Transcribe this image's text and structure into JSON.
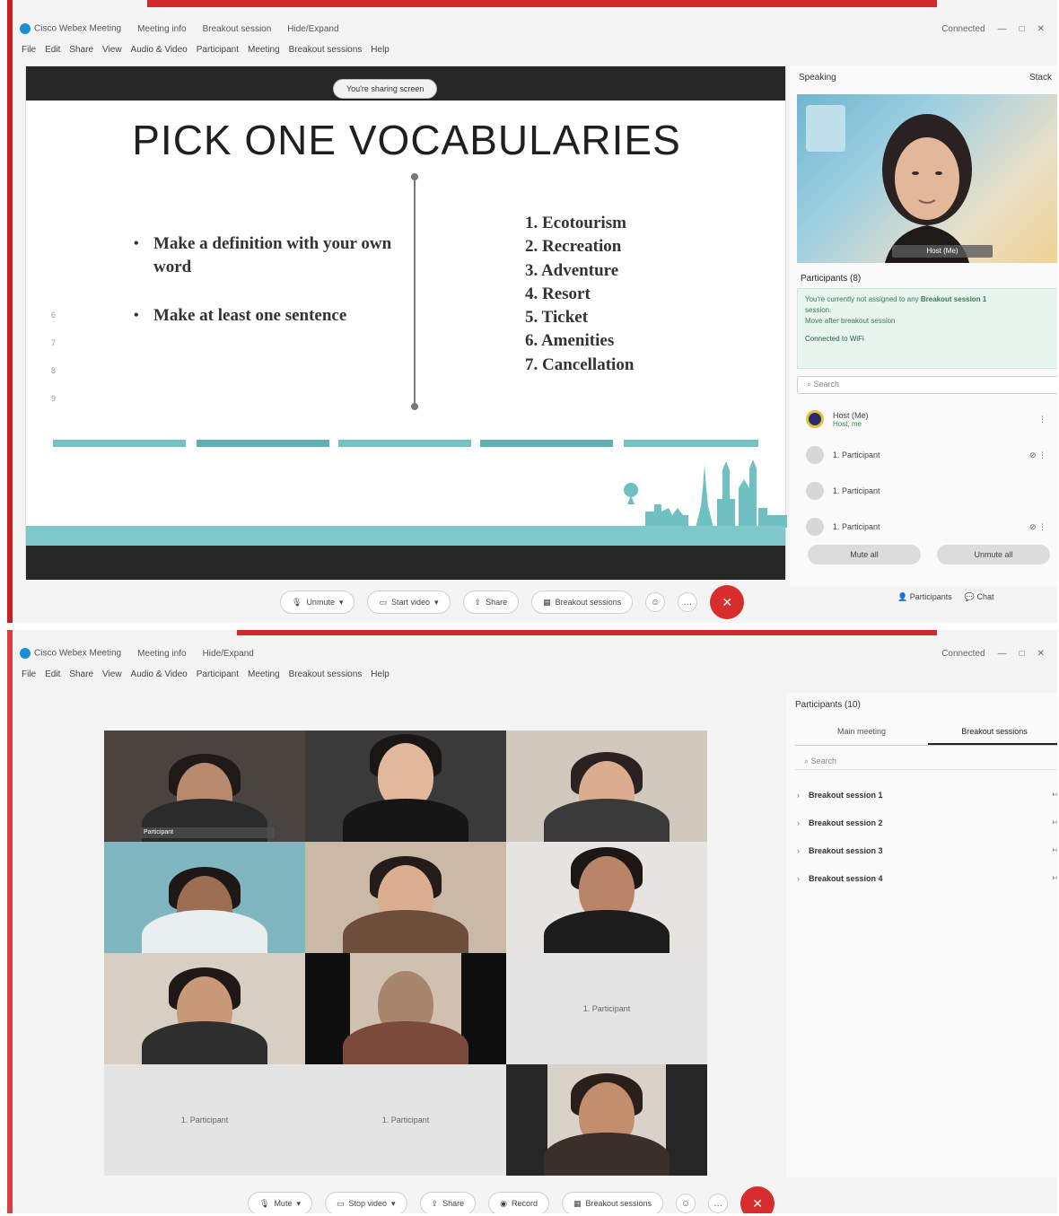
{
  "colors": {
    "accent_red": "#d22a2a",
    "slide_dark": "#262626",
    "slide_teal": "#7ec8c9",
    "panel_green": "#e8f4ee"
  },
  "top": {
    "titlebar": {
      "app": "Cisco Webex Meeting",
      "meeting_info": "Meeting info",
      "item_3": "Breakout session",
      "item_4": "Hide/Expand",
      "connected": "Connected",
      "icons": [
        "minimize-icon",
        "maximize-icon",
        "close-icon"
      ]
    },
    "menu": [
      "File",
      "Edit",
      "Share",
      "View",
      "Audio & Video",
      "Participant",
      "Meeting",
      "Breakout sessions",
      "Help"
    ],
    "slide": {
      "share_pill": "You're sharing screen",
      "title": "PICK ONE VOCABULARIES",
      "bullets": [
        "Make a definition with your own word",
        "Make at least one sentence"
      ],
      "vocab": [
        "1. Ecotourism",
        "2. Recreation",
        "3. Adventure",
        "4. Resort",
        "5. Ticket",
        "6. Amenities",
        "7. Cancellation"
      ],
      "margin_marks": [
        "6",
        "7",
        "8",
        "9"
      ]
    },
    "panel": {
      "head": "Speaking",
      "head_right": "Stack",
      "video_name": "Host (Me)",
      "participants_head": "Participants (8)",
      "info_line1": "You're currently not assigned to any",
      "info_bold": "Breakout session 1",
      "info_line2": "session.",
      "info_line3": "Move after breakout session",
      "info_conn": "Connected to WiFi",
      "search": "Search",
      "participants": [
        {
          "name": "Host (Me)",
          "sub": "Host, me"
        },
        {
          "name": "1. Participant",
          "sub": ""
        },
        {
          "name": "1. Participant",
          "sub": ""
        },
        {
          "name": "1. Participant",
          "sub": ""
        }
      ],
      "btn_mute_all": "Mute all",
      "btn_unmute_all": "Unmute all"
    },
    "toolbar": {
      "unmute": "Unmute",
      "start_video": "Start video",
      "share": "Share",
      "breakout": "Breakout sessions",
      "participants": "Participants",
      "chat": "Chat",
      "end_icon": "end-call-icon"
    }
  },
  "bottom": {
    "titlebar": {
      "app": "Cisco Webex Meeting",
      "meeting_info": "Meeting info",
      "item_3": "Hide/Expand",
      "connected": "Connected"
    },
    "menu": [
      "File",
      "Edit",
      "Share",
      "View",
      "Audio & Video",
      "Participant",
      "Meeting",
      "Breakout sessions",
      "Help"
    ],
    "grid": {
      "tile_tag": "Participant",
      "gray_tile": "1. Participant",
      "wide_left": "1. Participant",
      "wide_right": "1. Participant"
    },
    "panel": {
      "head": "Participants (10)",
      "tab_main": "Main meeting",
      "tab_breakout": "Breakout sessions",
      "search": "Search",
      "sessions": [
        "Breakout session 1",
        "Breakout session 2",
        "Breakout session 3",
        "Breakout session 4"
      ]
    },
    "toolbar": {
      "mute": "Mute",
      "stop_video": "Stop video",
      "share": "Share",
      "record": "Record",
      "breakout": "Breakout sessions"
    }
  }
}
